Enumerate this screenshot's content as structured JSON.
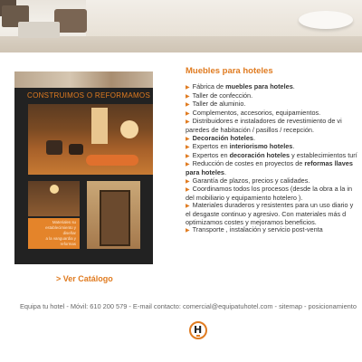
{
  "brochure": {
    "title": "CONSTRUIMOS O REFORMAMOS",
    "promo_lines": [
      "Materiales su",
      "establecimiento y diseñar",
      "a la vanguardia y",
      "reformas"
    ]
  },
  "catalog_link": "> Ver Catálogo",
  "section": {
    "heading": "Muebles para hoteles",
    "items": [
      {
        "pre": "Fábrica de ",
        "bold": "muebles para hoteles",
        "post": "."
      },
      {
        "pre": "Taller de confección.",
        "bold": "",
        "post": ""
      },
      {
        "pre": "Taller de aluminio.",
        "bold": "",
        "post": ""
      },
      {
        "pre": "Complementos, accesorios, equipamientos.",
        "bold": "",
        "post": ""
      },
      {
        "pre": "Distribuidores e instaladores de revestimiento de vi",
        "bold": "",
        "post": ""
      },
      {
        "pre": "paredes de habitación / pasillos / recepción.",
        "bold": "",
        "post": "",
        "continuation": true
      },
      {
        "pre": "",
        "bold": "Decoración hoteles",
        "post": "."
      },
      {
        "pre": "Expertos en ",
        "bold": "interiorismo hoteles",
        "post": "."
      },
      {
        "pre": "Expertos en ",
        "bold": "decoración hoteles",
        "post": " y establecimientos turí"
      },
      {
        "pre": "Reducción de costes en proyectos de ",
        "bold": "reformas llaves",
        "post": ""
      },
      {
        "pre": "",
        "bold": "para hoteles",
        "post": ".",
        "continuation": true
      },
      {
        "pre": "Garantía de plazos, precios y calidades.",
        "bold": "",
        "post": ""
      },
      {
        "pre": "Coordinamos todos los procesos (desde la obra a la in",
        "bold": "",
        "post": ""
      },
      {
        "pre": "del mobiliario y equipamiento hotelero ).",
        "bold": "",
        "post": "",
        "continuation": true
      },
      {
        "pre": "Materiales duraderos y resistentes para un uso diario y",
        "bold": "",
        "post": ""
      },
      {
        "pre": "el desgaste continuo y agresivo. Con materiales más d",
        "bold": "",
        "post": "",
        "continuation": true
      },
      {
        "pre": "optimizamos costes y mejoramos beneficios.",
        "bold": "",
        "post": "",
        "continuation": true
      },
      {
        "pre": "Transporte , instalación y servicio post-venta",
        "bold": "",
        "post": ""
      }
    ]
  },
  "footer": {
    "company": "Equipa tu hotel",
    "sep1": " - ",
    "phone": "Móvil: 610 200 579",
    "sep2": " - ",
    "email": "E-mail contacto: comercial@equipatuhotel.com",
    "sep3": " - ",
    "sitemap": "sitemap",
    "sep4": " - ",
    "seo": "posicionamiento"
  },
  "logo": {
    "letter": "H"
  },
  "colors": {
    "accent": "#e07b20",
    "text": "#333333",
    "footer": "#666666"
  }
}
